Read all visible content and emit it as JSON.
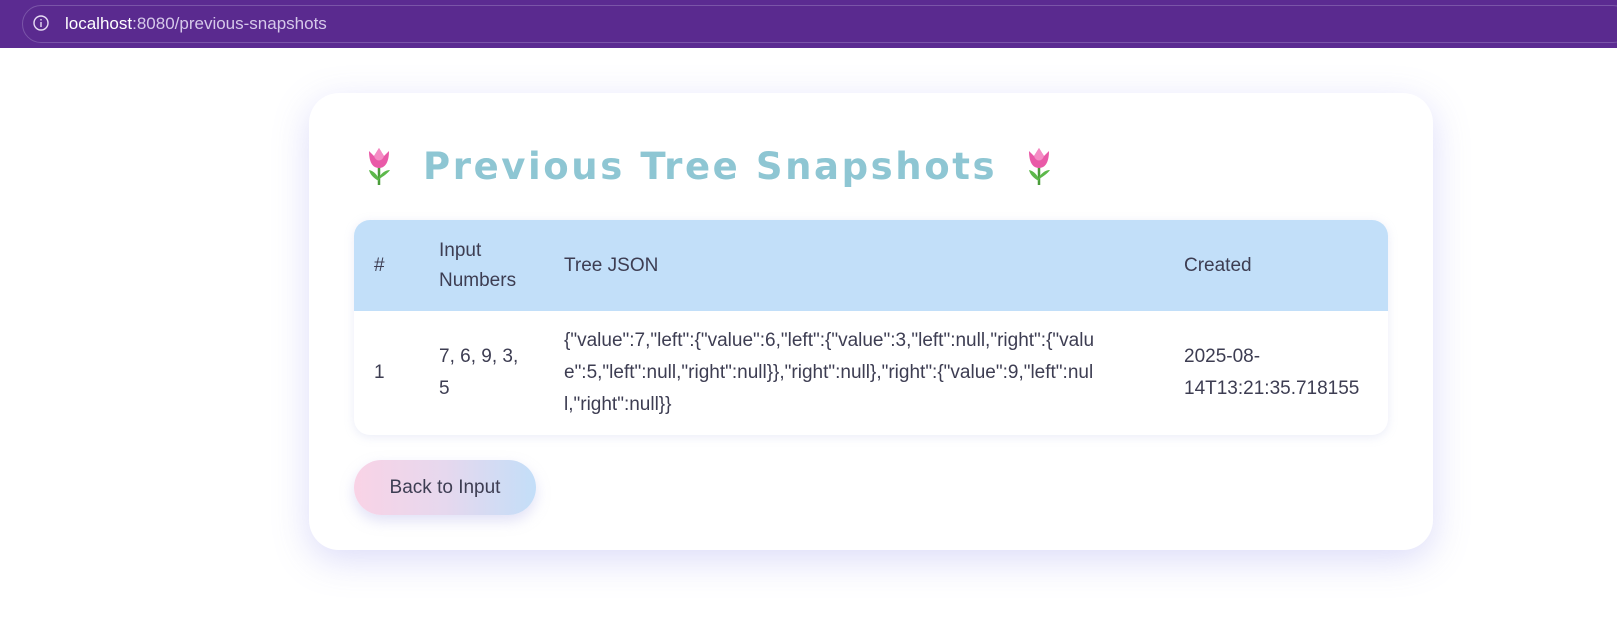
{
  "browser": {
    "url_host": "localhost",
    "url_path": ":8080/previous-snapshots"
  },
  "page": {
    "title": "Previous Tree Snapshots",
    "title_icon": "tulip-icon"
  },
  "table": {
    "headers": {
      "num": "#",
      "input": "Input Numbers",
      "json": "Tree JSON",
      "created": "Created"
    },
    "rows": [
      {
        "num": "1",
        "input": "7, 6, 9, 3, 5",
        "json": "{\"value\":7,\"left\":{\"value\":6,\"left\":{\"value\":3,\"left\":null,\"right\":{\"value\":5,\"left\":null,\"right\":null}},\"right\":null},\"right\":{\"value\":9,\"left\":null,\"right\":null}}",
        "created": "2025-08-14T13:21:35.718155"
      }
    ]
  },
  "actions": {
    "back_label": "Back to Input"
  },
  "colors": {
    "browser_bar": "#5b2b91",
    "title": "#8ec6d3",
    "table_header": "#c2dff9",
    "text": "#3d3d52"
  }
}
